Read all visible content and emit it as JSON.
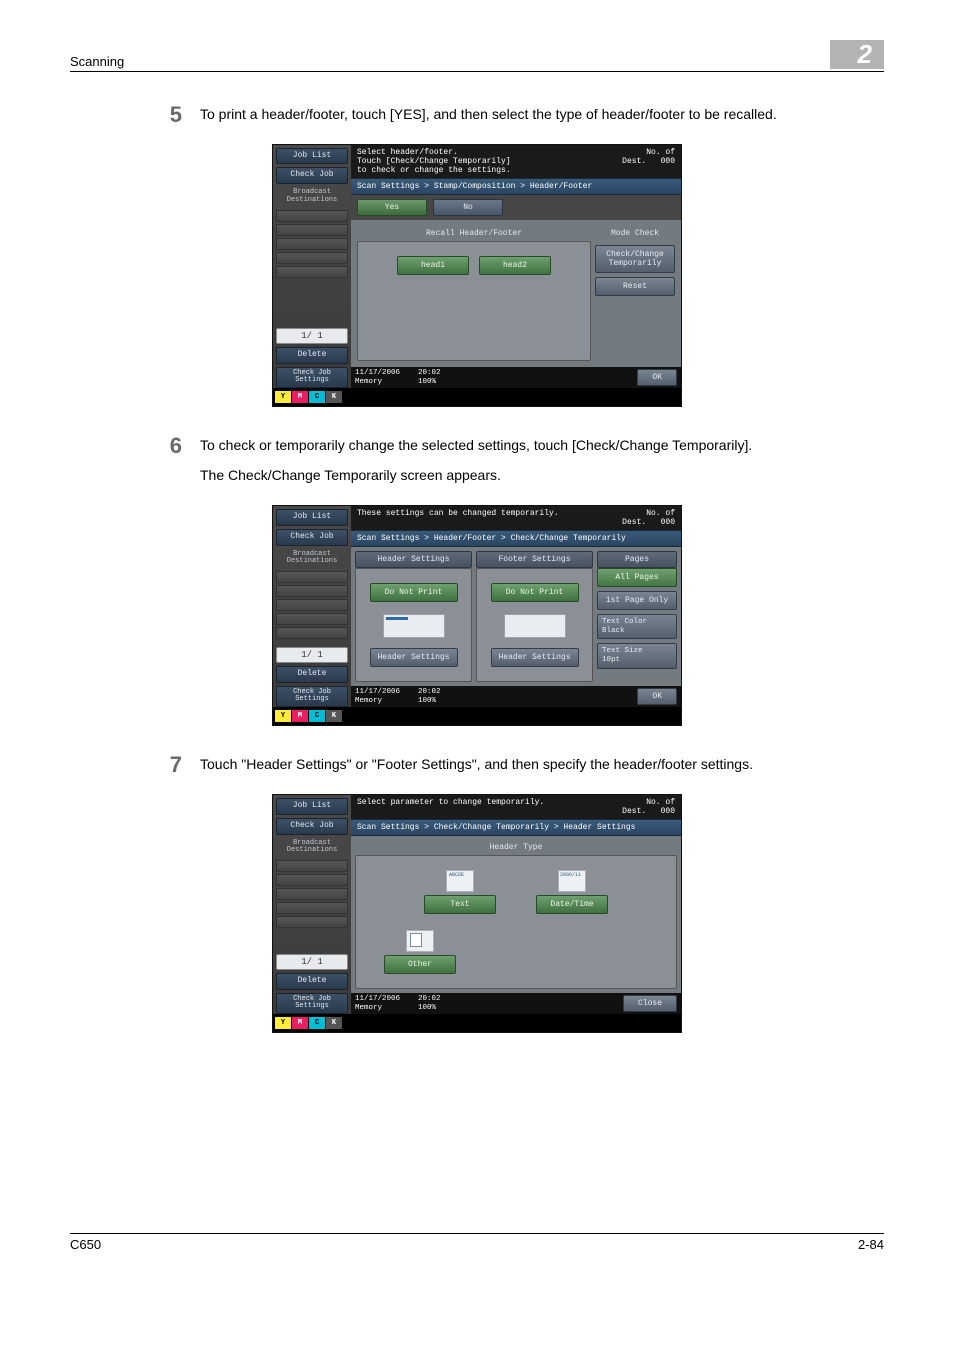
{
  "pageHeader": {
    "left": "Scanning",
    "chapter": "2"
  },
  "pageFooter": {
    "left": "C650",
    "right": "2-84"
  },
  "steps": {
    "s5": {
      "num": "5",
      "text": "To print a header/footer, touch [YES], and then select the type of header/footer to be recalled."
    },
    "s6": {
      "num": "6",
      "line1": "To check or temporarily change the selected settings, touch [Check/Change Temporarily].",
      "line2": "The Check/Change Temporarily screen appears."
    },
    "s7": {
      "num": "7",
      "text": "Touch \"Header Settings\" or \"Footer Settings\", and then specify the header/footer settings."
    }
  },
  "sidebar": {
    "jobList": "Job List",
    "checkJob": "Check Job",
    "broadcast": "Broadcast\nDestinations",
    "page": "1/  1",
    "del": "Delete",
    "checkJobSettings": "Check Job\nSettings",
    "toners": {
      "y": "Y",
      "m": "M",
      "c": "C",
      "k": "K"
    }
  },
  "common": {
    "destLabel": "No. of\nDest.",
    "destCount": "000",
    "footDate": "11/17/2006",
    "footTime": "20:02",
    "footMem": "Memory",
    "footPct": "100%",
    "ok": "OK",
    "close": "Close"
  },
  "screen1": {
    "msg": "Select header/footer.\nTouch [Check/Change Temporarily]\nto check or change the settings.",
    "crumb": "Scan Settings > Stamp/Composition > Header/Footer",
    "yes": "Yes",
    "no": "No",
    "recallTitle": "Recall Header/Footer",
    "modeCheck": "Mode Check",
    "head1": "head1",
    "head2": "head2",
    "checkChange": "Check/Change\nTemporarily",
    "reset": "Reset"
  },
  "screen2": {
    "msg": "These settings can be changed temporarily.",
    "crumb": "Scan Settings > Header/Footer > Check/Change Temporarily",
    "hdrSet": "Header Settings",
    "ftrSet": "Footer Settings",
    "pages": "Pages",
    "doNotPrint": "Do Not Print",
    "allPages": "All Pages",
    "firstPage": "1st Page Only",
    "textColor": "Text Color\nBlack",
    "textSize": "Text Size\n10pt",
    "hdrSetBtn": "Header Settings"
  },
  "screen3": {
    "msg": "Select parameter to change temporarily.",
    "crumb": "Scan Settings > Check/Change Temporarily > Header Settings",
    "headerType": "Header Type",
    "text": "Text",
    "dateTime": "Date/Time",
    "other": "Other"
  }
}
